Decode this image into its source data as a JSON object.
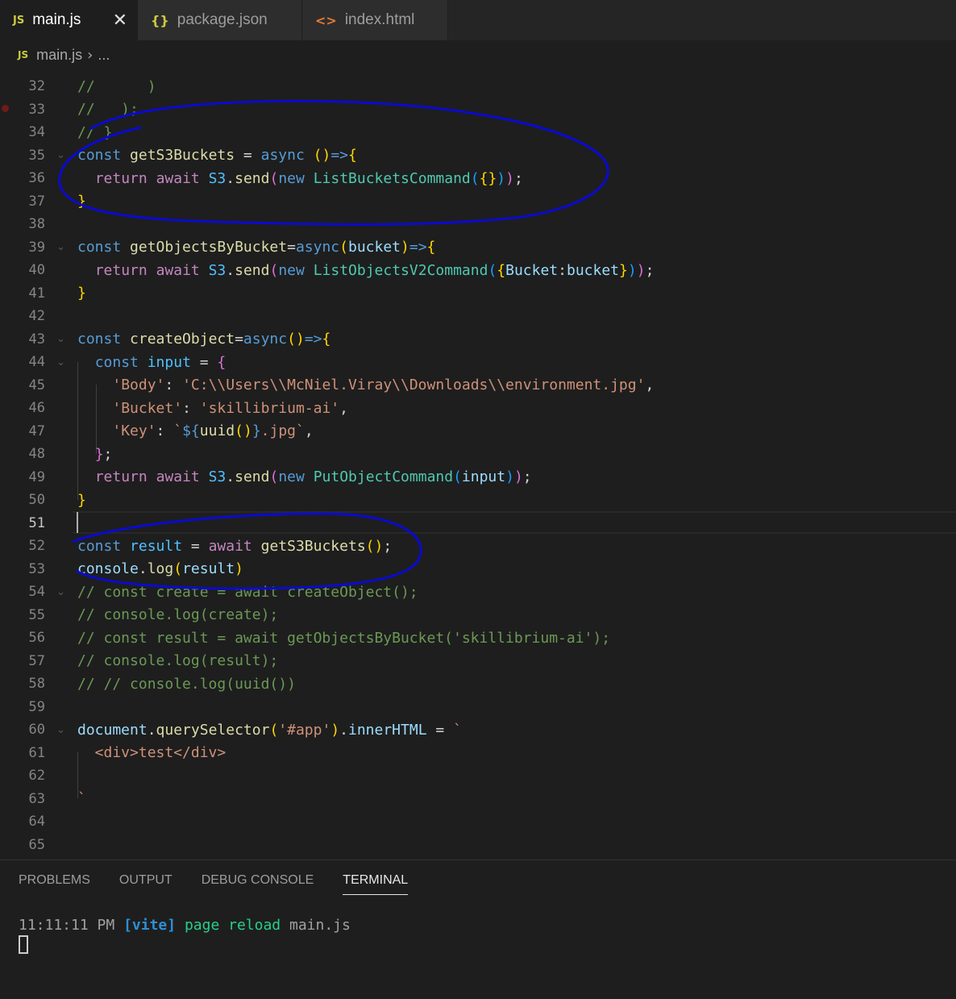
{
  "tabs": [
    {
      "icon": "JS",
      "label": "main.js",
      "close": "✕"
    },
    {
      "icon": "{}",
      "label": "package.json"
    },
    {
      "icon": "<>",
      "label": "index.html"
    }
  ],
  "breadcrumb": {
    "icon": "JS",
    "file": "main.js",
    "sep": "›",
    "more": "..."
  },
  "lines": [
    {
      "n": "32",
      "html": "<span class=\"c\">//      )</span>"
    },
    {
      "n": "33",
      "html": "<span class=\"c\">//   );</span>"
    },
    {
      "n": "34",
      "html": "<span class=\"c\">// }</span>"
    },
    {
      "n": "35",
      "html": "<span class=\"k\">const</span> <span class=\"f\">getS3Buckets</span> <span class=\"p\">=</span> <span class=\"k\">async</span> <span class=\"b1\">()</span><span class=\"k\">=&gt;</span><span class=\"b1\">{</span>"
    },
    {
      "n": "36",
      "html": "  <span class=\"ctl\">return</span> <span class=\"ctl\">await</span> <span class=\"n\">S3</span>.<span class=\"f\">send</span><span class=\"b2\">(</span><span class=\"k\">new</span> <span class=\"t\">ListBucketsCommand</span><span class=\"b3\">(</span><span class=\"b1\">{}</span><span class=\"b3\">)</span><span class=\"b2\">)</span>;"
    },
    {
      "n": "37",
      "html": "<span class=\"b1\">}</span>"
    },
    {
      "n": "38",
      "html": ""
    },
    {
      "n": "39",
      "html": "<span class=\"k\">const</span> <span class=\"f\">getObjectsByBucket</span>=<span class=\"k\">async</span><span class=\"b1\">(</span><span class=\"v\">bucket</span><span class=\"b1\">)</span><span class=\"k\">=&gt;</span><span class=\"b1\">{</span>"
    },
    {
      "n": "40",
      "html": "  <span class=\"ctl\">return</span> <span class=\"ctl\">await</span> <span class=\"n\">S3</span>.<span class=\"f\">send</span><span class=\"b2\">(</span><span class=\"k\">new</span> <span class=\"t\">ListObjectsV2Command</span><span class=\"b3\">(</span><span class=\"b1\">{</span><span class=\"v\">Bucket</span>:<span class=\"v\">bucket</span><span class=\"b1\">}</span><span class=\"b3\">)</span><span class=\"b2\">)</span>;"
    },
    {
      "n": "41",
      "html": "<span class=\"b1\">}</span>"
    },
    {
      "n": "42",
      "html": ""
    },
    {
      "n": "43",
      "html": "<span class=\"k\">const</span> <span class=\"f\">createObject</span>=<span class=\"k\">async</span><span class=\"b1\">()</span><span class=\"k\">=&gt;</span><span class=\"b1\">{</span>"
    },
    {
      "n": "44",
      "html": "  <span class=\"k\">const</span> <span class=\"n\">input</span> = <span class=\"b2\">{</span>"
    },
    {
      "n": "45",
      "html": "    <span class=\"s\">'Body'</span>: <span class=\"s\">'C:\\\\Users\\\\McNiel.Viray\\\\Downloads\\\\environment.jpg'</span>,"
    },
    {
      "n": "46",
      "html": "    <span class=\"s\">'Bucket'</span>: <span class=\"s\">'skillibrium-ai'</span>,"
    },
    {
      "n": "47",
      "html": "    <span class=\"s\">'Key'</span>: <span class=\"s\">`</span><span class=\"tp\">${</span><span class=\"f\">uuid</span><span class=\"b1\">()</span><span class=\"tp\">}</span><span class=\"s\">.jpg`</span>,"
    },
    {
      "n": "48",
      "html": "  <span class=\"b2\">}</span>;"
    },
    {
      "n": "49",
      "html": "  <span class=\"ctl\">return</span> <span class=\"ctl\">await</span> <span class=\"n\">S3</span>.<span class=\"f\">send</span><span class=\"b2\">(</span><span class=\"k\">new</span> <span class=\"t\">PutObjectCommand</span><span class=\"b3\">(</span><span class=\"v\">input</span><span class=\"b3\">)</span><span class=\"b2\">)</span>;"
    },
    {
      "n": "50",
      "html": "<span class=\"b1\">}</span>"
    },
    {
      "n": "51",
      "html": ""
    },
    {
      "n": "52",
      "html": "<span class=\"k\">const</span> <span class=\"n\">result</span> = <span class=\"ctl\">await</span> <span class=\"f\">getS3Buckets</span><span class=\"b1\">()</span>;"
    },
    {
      "n": "53",
      "html": "<span class=\"v\">console</span>.<span class=\"f\">log</span><span class=\"b1\">(</span><span class=\"v\">result</span><span class=\"b1\">)</span>"
    },
    {
      "n": "54",
      "html": "<span class=\"c\">// const create = await createObject();</span>"
    },
    {
      "n": "55",
      "html": "<span class=\"c\">// console.log(create);</span>"
    },
    {
      "n": "56",
      "html": "<span class=\"c\">// const result = await getObjectsByBucket('skillibrium-ai');</span>"
    },
    {
      "n": "57",
      "html": "<span class=\"c\">// console.log(result);</span>"
    },
    {
      "n": "58",
      "html": "<span class=\"c\">// // console.log(uuid())</span>"
    },
    {
      "n": "59",
      "html": ""
    },
    {
      "n": "60",
      "html": "<span class=\"v\">document</span>.<span class=\"f\">querySelector</span><span class=\"b1\">(</span><span class=\"s\">'#app'</span><span class=\"b1\">)</span>.<span class=\"v\">innerHTML</span> = <span class=\"s\">`</span>"
    },
    {
      "n": "61",
      "html": "<span class=\"s\">  &lt;div&gt;test&lt;/div&gt;</span>"
    },
    {
      "n": "62",
      "html": ""
    },
    {
      "n": "63",
      "html": "<span class=\"s\">`</span>"
    },
    {
      "n": "64",
      "html": ""
    },
    {
      "n": "65",
      "html": ""
    }
  ],
  "panel": {
    "tabs": [
      "PROBLEMS",
      "OUTPUT",
      "DEBUG CONSOLE",
      "TERMINAL"
    ],
    "terminal": {
      "time": "11:11:11 PM",
      "tag": "[vite]",
      "msg": "page reload",
      "file": "main.js"
    }
  },
  "colors": {
    "editor_bg": "#1e1e1e",
    "annotation": "#0a0ad0",
    "keyword": "#569cd6",
    "comment": "#6a9955"
  }
}
